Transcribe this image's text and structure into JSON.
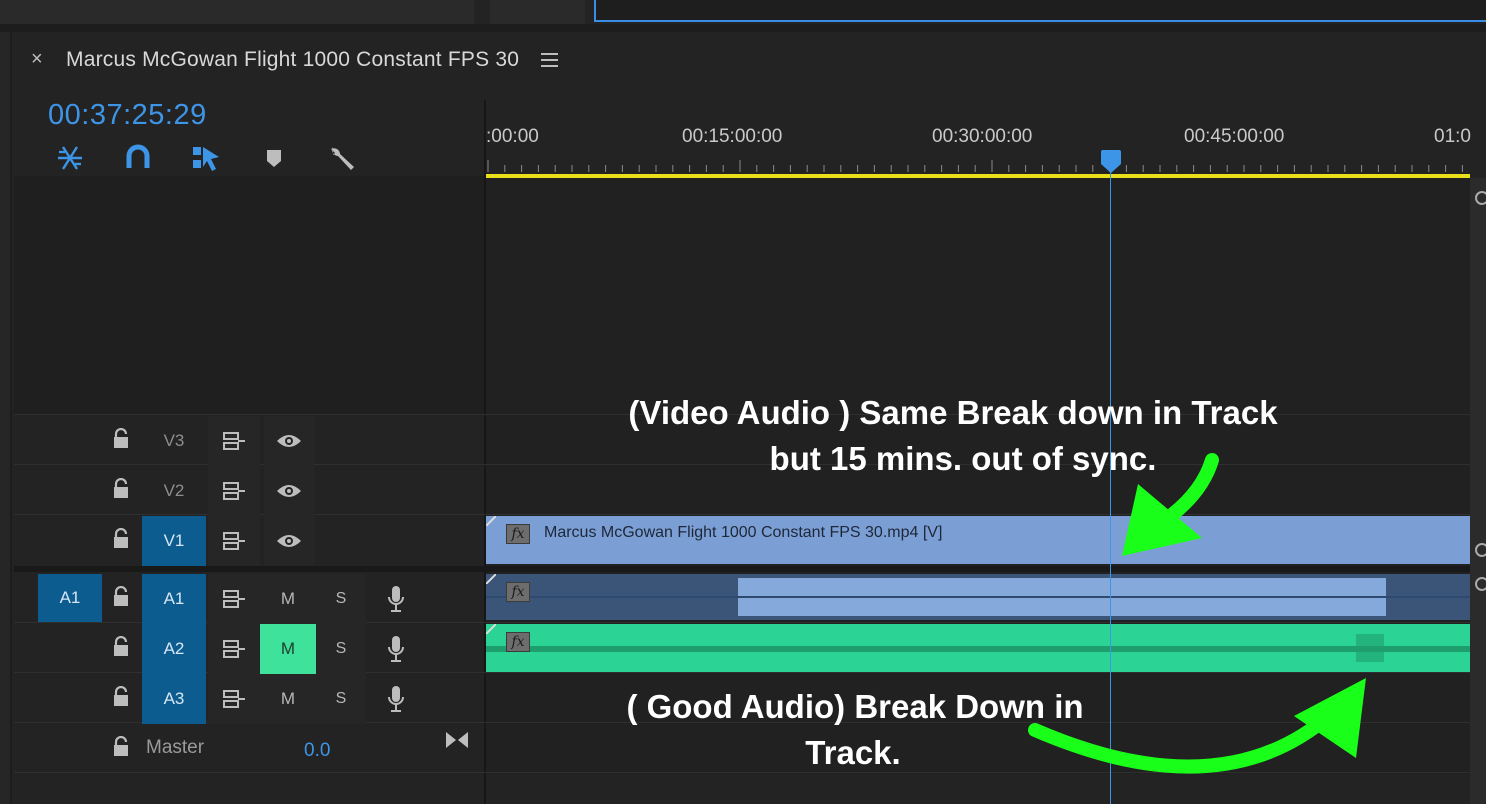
{
  "sequence": {
    "title": "Marcus McGowan Flight 1000 Constant FPS 30",
    "timecode": "00:37:25:29"
  },
  "tools": [
    {
      "name": "nest-sequence-icon"
    },
    {
      "name": "snap-magnet-icon"
    },
    {
      "name": "linked-selection-icon"
    },
    {
      "name": "add-marker-icon"
    },
    {
      "name": "wrench-icon"
    }
  ],
  "ruler": {
    "labels": [
      ":00:00",
      "00:15:00:00",
      "00:30:00:00",
      "00:45:00:00",
      "01:0"
    ]
  },
  "tracks": {
    "video": [
      {
        "name": "V3",
        "targeted": false
      },
      {
        "name": "V2",
        "targeted": false
      },
      {
        "name": "V1",
        "targeted": true
      }
    ],
    "audio": [
      {
        "name": "A1",
        "source": "A1",
        "mute_label": "M",
        "solo_label": "S",
        "muted": false
      },
      {
        "name": "A2",
        "source": "",
        "mute_label": "M",
        "solo_label": "S",
        "muted": true
      },
      {
        "name": "A3",
        "source": "",
        "mute_label": "M",
        "solo_label": "S",
        "muted": false
      }
    ],
    "master": {
      "label": "Master",
      "value": "0.0"
    }
  },
  "clips": {
    "video_clip_label": "Marcus McGowan Flight 1000 Constant FPS 30.mp4 [V]",
    "fx_badge": "fx"
  },
  "annotations": {
    "top_line1": "(Video Audio ) Same Break down in Track",
    "top_line2": "but 15 mins. out of sync.",
    "bottom_line1": "( Good Audio) Break Down in",
    "bottom_line2": "Track."
  },
  "colors": {
    "timecode": "#3d95e8",
    "video_clip": "#7b9fd4",
    "audio_clip_a1": "#3b5578",
    "audio_clip_a2": "#2bd494",
    "arrow": "#19ff19",
    "work_area_bar": "#e9e01b"
  }
}
